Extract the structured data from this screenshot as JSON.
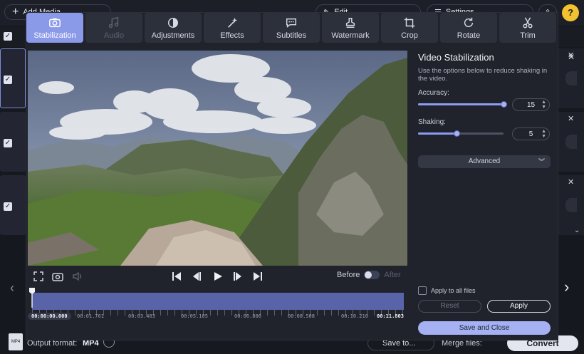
{
  "main": {
    "add_media_label": "Add Media",
    "edit_label": "Edit",
    "settings_label": "Settings",
    "output_format_label": "Output format:",
    "output_format_value": "MP4",
    "save_to_label": "Save to...",
    "merge_files_label": "Merge files:",
    "convert_label": "Convert",
    "help_label": "?"
  },
  "tabs": [
    {
      "label": "Stabilization",
      "icon": "camera-stabilize-icon",
      "state": "active"
    },
    {
      "label": "Audio",
      "icon": "music-note-icon",
      "state": "disabled"
    },
    {
      "label": "Adjustments",
      "icon": "contrast-icon",
      "state": "normal"
    },
    {
      "label": "Effects",
      "icon": "magic-wand-icon",
      "state": "normal"
    },
    {
      "label": "Subtitles",
      "icon": "speech-bubble-icon",
      "state": "normal"
    },
    {
      "label": "Watermark",
      "icon": "stamp-icon",
      "state": "normal"
    },
    {
      "label": "Crop",
      "icon": "crop-icon",
      "state": "normal"
    },
    {
      "label": "Rotate",
      "icon": "rotate-icon",
      "state": "normal"
    },
    {
      "label": "Trim",
      "icon": "scissors-icon",
      "state": "normal"
    }
  ],
  "player": {
    "before_label": "Before",
    "after_label": "After",
    "playhead_fraction": 0.0,
    "timecodes": [
      "00:00:00.000",
      "00:01.701",
      "00:03.403",
      "00:05.105",
      "00:06.806",
      "00:08.508",
      "00:10.210",
      "00:11.803"
    ]
  },
  "panel": {
    "title": "Video Stabilization",
    "description": "Use the options below to reduce shaking in the video.",
    "accuracy_label": "Accuracy:",
    "accuracy_value": "15",
    "accuracy_fraction": 1.0,
    "shaking_label": "Shaking:",
    "shaking_value": "5",
    "shaking_fraction": 0.45,
    "advanced_label": "Advanced",
    "apply_all_label": "Apply to all files",
    "reset_label": "Reset",
    "apply_label": "Apply",
    "save_close_label": "Save and Close"
  },
  "colors": {
    "accent": "#8a99e8",
    "timeline": "#5863a8",
    "save_button": "#a5b1f3"
  }
}
